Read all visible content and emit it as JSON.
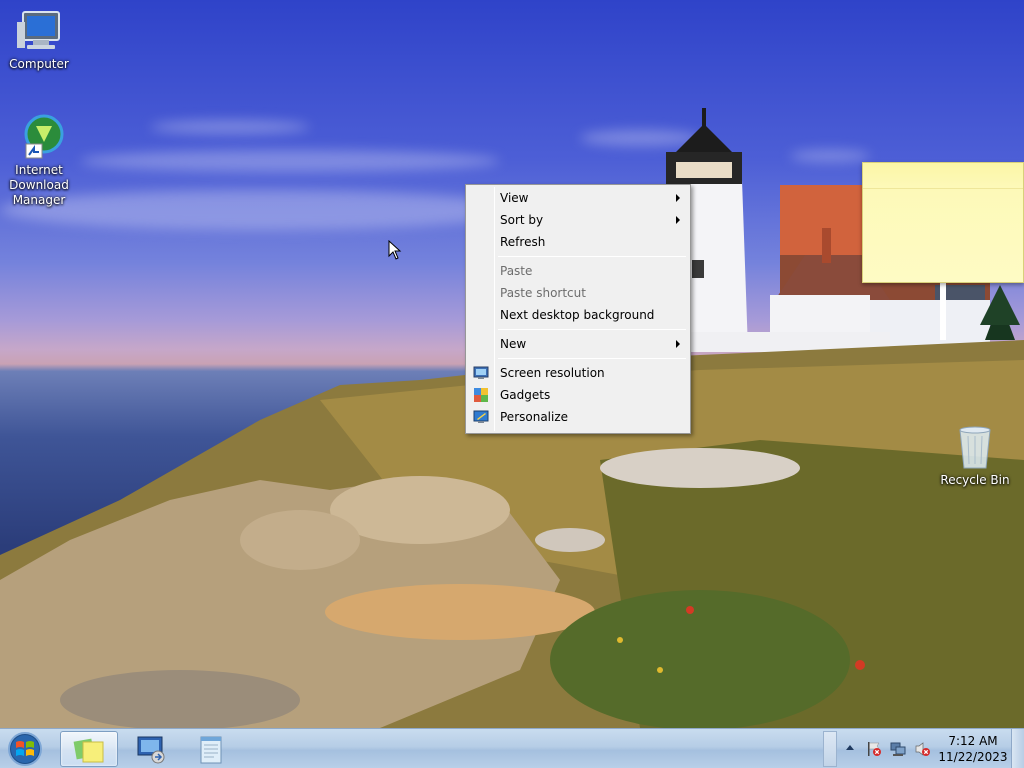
{
  "desktop": {
    "icons": [
      {
        "label": "Computer",
        "icon": "computer-icon"
      },
      {
        "label": "Internet Download Manager",
        "icon": "internet-download-manager-icon"
      },
      {
        "label": "Recycle Bin",
        "icon": "recycle-bin-icon"
      }
    ]
  },
  "context_menu": {
    "items": [
      {
        "label": "View",
        "submenu": true,
        "enabled": true
      },
      {
        "label": "Sort by",
        "submenu": true,
        "enabled": true
      },
      {
        "label": "Refresh",
        "submenu": false,
        "enabled": true
      },
      {
        "label": "Paste",
        "submenu": false,
        "enabled": false
      },
      {
        "label": "Paste shortcut",
        "submenu": false,
        "enabled": false
      },
      {
        "label": "Next desktop background",
        "submenu": false,
        "enabled": true
      },
      {
        "label": "New",
        "submenu": true,
        "enabled": true
      },
      {
        "label": "Screen resolution",
        "submenu": false,
        "enabled": true,
        "icon": "screen-resolution-icon"
      },
      {
        "label": "Gadgets",
        "submenu": false,
        "enabled": true,
        "icon": "gadgets-icon"
      },
      {
        "label": "Personalize",
        "submenu": false,
        "enabled": true,
        "icon": "personalize-icon"
      }
    ]
  },
  "taskbar": {
    "pinned": [
      {
        "icon": "sticky-notes-icon",
        "active": true
      },
      {
        "icon": "remote-desktop-icon",
        "active": false
      },
      {
        "icon": "notepad-icon",
        "active": false
      }
    ],
    "clock": {
      "time": "7:12 AM",
      "date": "11/22/2023"
    }
  },
  "colors": {
    "menu_bg": "#f0f0f0",
    "taskbar": "#b6cde6",
    "sticky_note": "#fefbc4"
  }
}
